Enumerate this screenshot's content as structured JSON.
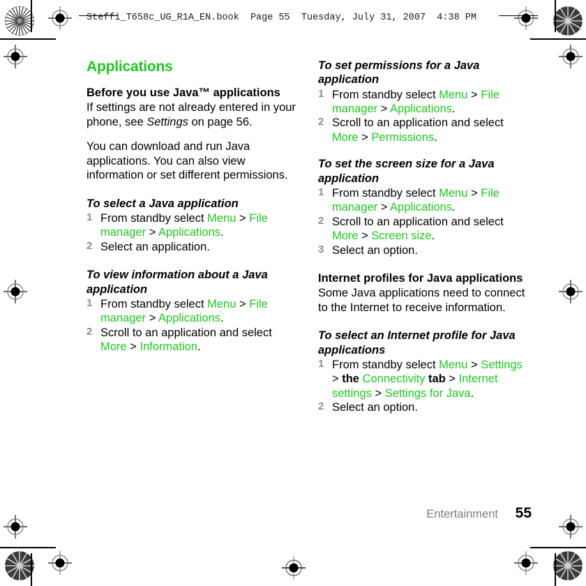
{
  "document": {
    "file_header": "Steffi_T658c_UG_R1A_EN.book  Page 55  Tuesday, July 31, 2007  4:38 PM",
    "accent_green": "#22c522",
    "step_number_color": "#8c8c8c",
    "footer_chapter_color": "#7d7d7d"
  },
  "left_column": {
    "section_title": "Applications",
    "intro_heading": "Before you use Java™ applications",
    "intro_paragraph_1_a": "If settings are not already entered in your phone, see ",
    "intro_paragraph_1_italic": "Settings",
    "intro_paragraph_1_b": " on page 56.",
    "intro_paragraph_2": "You can download and run Java applications. You can also view information or set different permissions.",
    "proc_1": {
      "heading": "To select a Java application",
      "steps": [
        {
          "num": "1",
          "lead": "From standby select ",
          "g1": "Menu",
          "sep1": " > ",
          "g2": "File manager",
          "sep2": " > ",
          "g3": "Applications",
          "tail": "."
        },
        {
          "num": "2",
          "lead": "Select an application.",
          "g1": "",
          "sep1": "",
          "g2": "",
          "sep2": "",
          "g3": "",
          "tail": ""
        }
      ]
    },
    "proc_2": {
      "heading": "To view information about a Java application",
      "steps": [
        {
          "num": "1",
          "lead": "From standby select ",
          "g1": "Menu",
          "sep1": " > ",
          "g2": "File manager",
          "sep2": " > ",
          "g3": "Applications",
          "tail": "."
        },
        {
          "num": "2",
          "lead": "Scroll to an application and select ",
          "g1": "More",
          "sep1": " > ",
          "g2": "Information",
          "sep2": "",
          "g3": "",
          "tail": "."
        }
      ]
    }
  },
  "right_column": {
    "proc_3": {
      "heading": "To set permissions for a Java application",
      "steps": [
        {
          "num": "1",
          "lead": "From standby select ",
          "g1": "Menu",
          "sep1": " > ",
          "g2": "File manager",
          "sep2": " > ",
          "g3": "Applications",
          "tail": "."
        },
        {
          "num": "2",
          "lead": "Scroll to an application and select ",
          "g1": "More",
          "sep1": " > ",
          "g2": "Permissions",
          "sep2": "",
          "g3": "",
          "tail": "."
        }
      ]
    },
    "proc_4": {
      "heading": "To set the screen size for a Java application",
      "steps": [
        {
          "num": "1",
          "lead": "From standby select ",
          "g1": "Menu",
          "sep1": " > ",
          "g2": "File manager",
          "sep2": " > ",
          "g3": "Applications",
          "tail": "."
        },
        {
          "num": "2",
          "lead": "Scroll to an application and select ",
          "g1": "More",
          "sep1": " > ",
          "g2": "Screen size",
          "sep2": "",
          "g3": "",
          "tail": "."
        },
        {
          "num": "3",
          "lead": "Select an option.",
          "g1": "",
          "sep1": "",
          "g2": "",
          "sep2": "",
          "g3": "",
          "tail": ""
        }
      ]
    },
    "internet_heading": "Internet profiles for Java applications",
    "internet_paragraph": "Some Java applications need to connect to the Internet to receive information.",
    "proc_5": {
      "heading": "To select an Internet profile for Java applications",
      "step1": {
        "num": "1",
        "lead": "From standby select ",
        "g1": "Menu",
        "sep1": " > ",
        "g2": "Settings",
        "sep2": " > ",
        "bold_the": "the",
        "g3": "Connectivity",
        "bold_tab": "tab",
        "sep3": " > ",
        "g4": "Internet settings",
        "sep4": " > ",
        "g5": "Settings for Java",
        "tail": "."
      },
      "step2": {
        "num": "2",
        "lead": "Select an option."
      }
    }
  },
  "footer": {
    "chapter": "Entertainment",
    "page_number": "55"
  }
}
